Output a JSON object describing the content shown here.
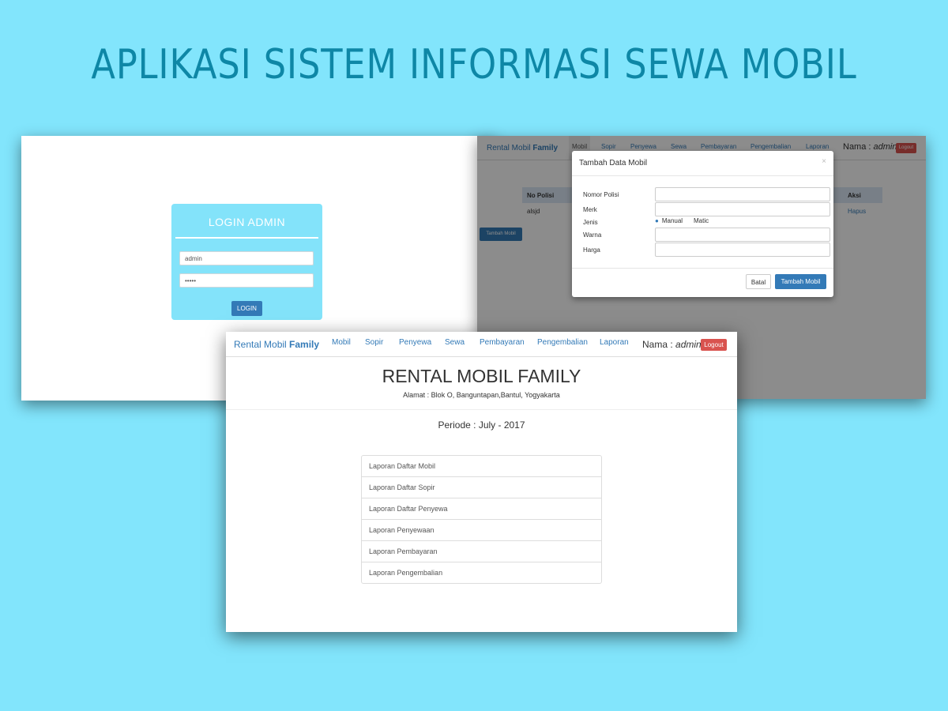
{
  "banner_title": "APLIKASI SISTEM INFORMASI SEWA MOBIL",
  "login": {
    "title": "LOGIN ADMIN",
    "username_value": "admin",
    "password_value": "•••••",
    "button_label": "LOGIN"
  },
  "mobil_screen": {
    "brand_prefix": "Rental Mobil",
    "brand_bold": "Family",
    "nav_items": [
      "Mobil",
      "Sopir",
      "Penyewa",
      "Sewa",
      "Pembayaran",
      "Pengembalian",
      "Laporan"
    ],
    "nama_label": "Nama :",
    "nama_user": "admin",
    "logout_label": "Logout",
    "table_headers": {
      "no_polisi": "No Polisi",
      "aksi": "Aksi"
    },
    "table_row": {
      "no_polisi": "alsjd",
      "aksi": "Hapus"
    },
    "tambah_button": "Tambah Mobil",
    "modal": {
      "title": "Tambah Data Mobil",
      "close": "×",
      "labels": [
        "Nomor Polisi",
        "Merk",
        "Jenis",
        "Warna",
        "Harga"
      ],
      "radio_options": [
        "Manual",
        "Matic"
      ],
      "cancel_label": "Batal",
      "submit_label": "Tambah Mobil"
    }
  },
  "laporan_screen": {
    "brand_prefix": "Rental Mobil",
    "brand_bold": "Family",
    "nav_items": [
      "Mobil",
      "Sopir",
      "Penyewa",
      "Sewa",
      "Pembayaran",
      "Pengembalian",
      "Laporan"
    ],
    "nama_label": "Nama :",
    "nama_user": "admin",
    "logout_label": "Logout",
    "heading": "RENTAL MOBIL FAMILY",
    "alamat": "Alamat : Blok O, Banguntapan,Bantul, Yogyakarta",
    "periode": "Periode : July - 2017",
    "reports": [
      "Laporan Daftar Mobil",
      "Laporan Daftar Sopir",
      "Laporan Daftar Penyewa",
      "Laporan Penyewaan",
      "Laporan Pembayaran",
      "Laporan Pengembalian"
    ]
  },
  "colors": {
    "background": "#82e5fc",
    "title": "#0e87a6",
    "primary": "#337ab7",
    "danger": "#d9534f",
    "login_box": "#83e3fa"
  }
}
